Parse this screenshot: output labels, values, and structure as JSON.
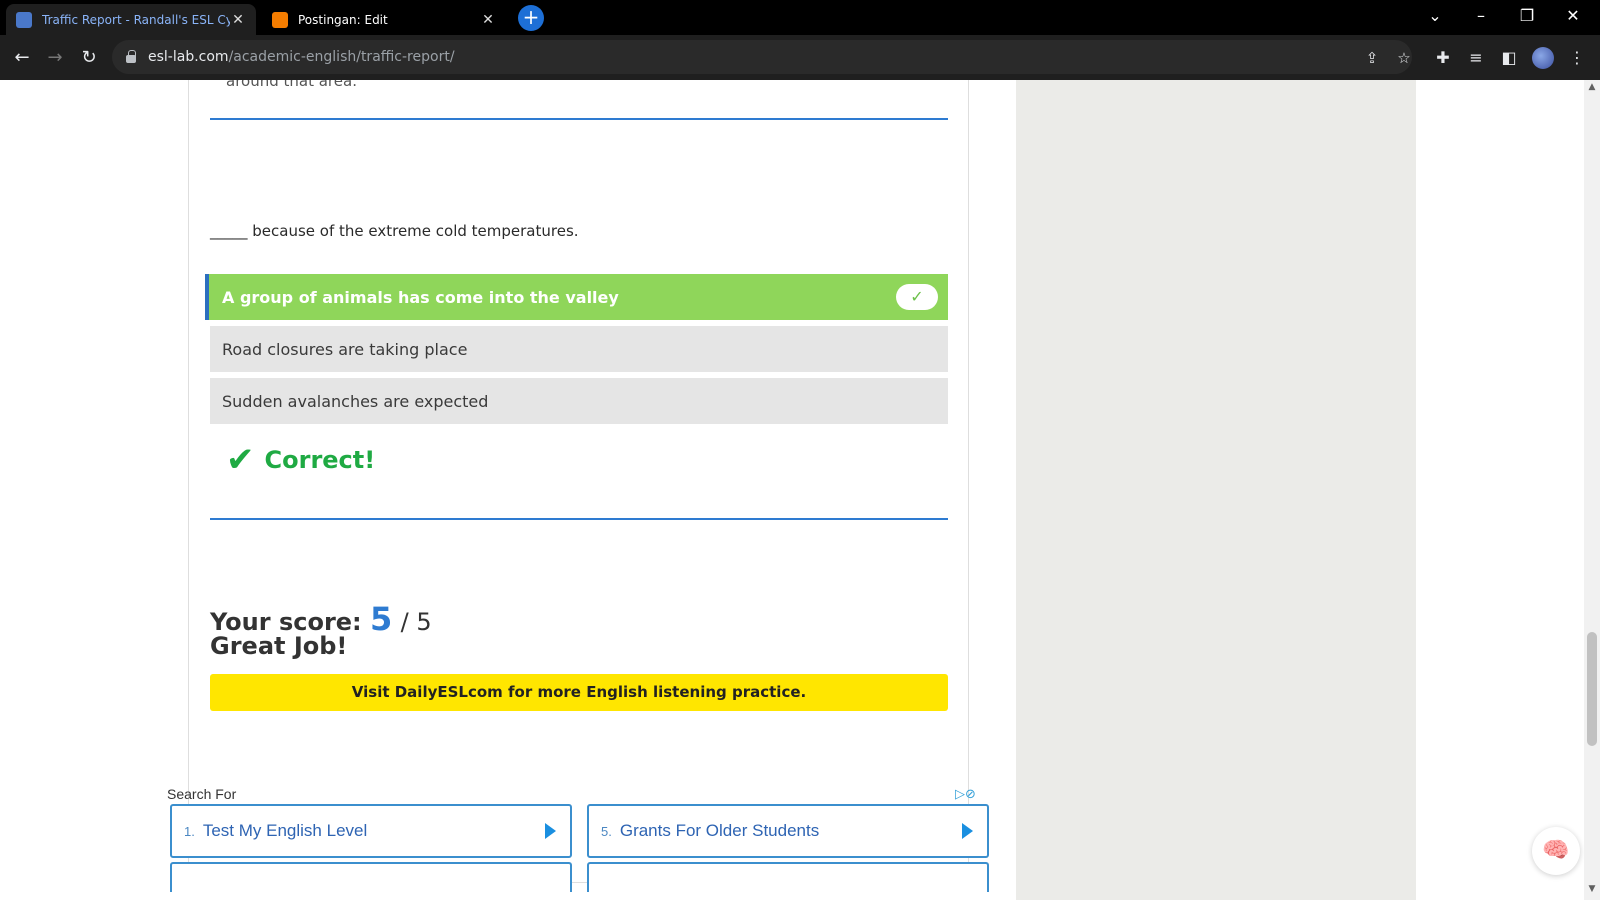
{
  "browser": {
    "tabs": [
      {
        "title": "Traffic Report - Randall's ESL Cyb",
        "favicon": "esl-favicon",
        "active": true
      },
      {
        "title": "Postingan: Edit",
        "favicon": "blogger-icon",
        "active": false
      }
    ],
    "url_domain": "esl-lab.com",
    "url_path": "/academic-english/traffic-report/"
  },
  "quiz": {
    "previous_text": "around that area.",
    "question": "_____ because of the extreme cold temperatures.",
    "answers": [
      {
        "label": "A group of animals has come into the valley",
        "state": "correct"
      },
      {
        "label": "Road closures are taking place",
        "state": "unselected"
      },
      {
        "label": "Sudden avalanches are expected",
        "state": "unselected"
      }
    ],
    "feedback": "Correct!",
    "score_label": "Your score:",
    "score": "5",
    "score_total": "/ 5",
    "message": "Great Job!",
    "visit_button": "Visit DailyESLcom for more English listening practice."
  },
  "ads": {
    "search_for": "Search For",
    "links": [
      {
        "index": "1.",
        "text": "Test My English Level"
      },
      {
        "index": "5.",
        "text": "Grants For Older Students"
      }
    ]
  },
  "colors": {
    "correct_green": "#8fd65a",
    "feedback_green": "#1faa43",
    "accent_blue": "#2e7bd1",
    "visit_yellow": "#ffe600"
  }
}
